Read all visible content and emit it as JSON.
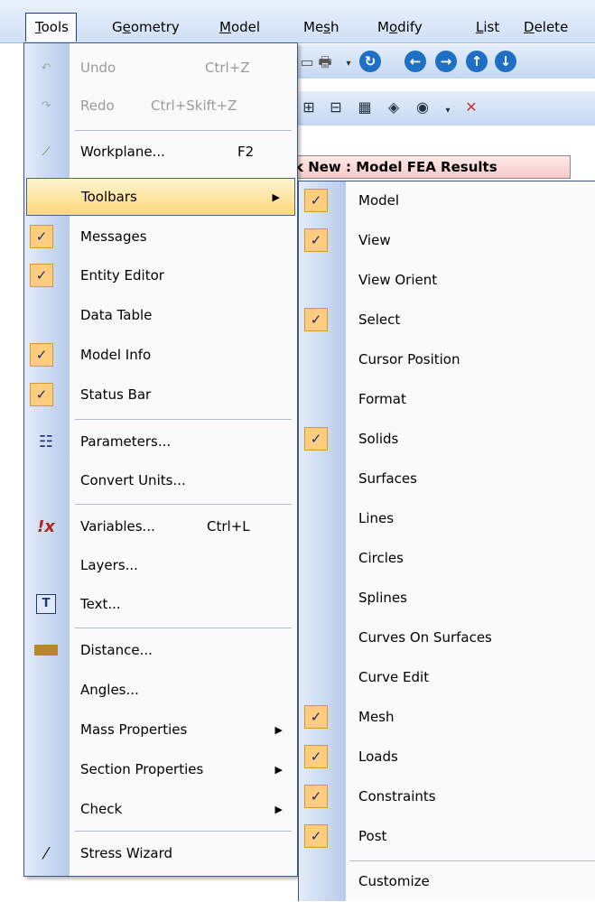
{
  "menubar": {
    "items": [
      "Tools",
      "Geometry",
      "Model",
      "Mesh",
      "Modify",
      "List",
      "Delete"
    ]
  },
  "document_tab": {
    "title": "k New : Model FEA Results"
  },
  "tools_menu": {
    "items": [
      {
        "label": "Undo",
        "shortcut": "Ctrl+Z",
        "icon": "undo-icon",
        "disabled": true
      },
      {
        "label": "Redo",
        "shortcut": "Ctrl+Skift+Z",
        "icon": "redo-icon",
        "disabled": true
      },
      {
        "label": "Workplane...",
        "shortcut": "F2",
        "icon": "workplane-icon"
      },
      {
        "label": "Toolbars",
        "submenu": true,
        "highlighted": true
      },
      {
        "label": "Messages",
        "checked": true
      },
      {
        "label": "Entity Editor",
        "checked": true
      },
      {
        "label": "Data Table"
      },
      {
        "label": "Model Info",
        "checked": true
      },
      {
        "label": "Status Bar",
        "checked": true
      },
      {
        "label": "Parameters...",
        "icon": "parameters-icon"
      },
      {
        "label": "Convert Units..."
      },
      {
        "label": "Variables...",
        "shortcut": "Ctrl+L",
        "icon": "variables-icon"
      },
      {
        "label": "Layers..."
      },
      {
        "label": "Text...",
        "icon": "text-icon"
      },
      {
        "label": "Distance...",
        "icon": "ruler-icon"
      },
      {
        "label": "Angles..."
      },
      {
        "label": "Mass Properties",
        "submenu": true
      },
      {
        "label": "Section Properties",
        "submenu": true
      },
      {
        "label": "Check",
        "submenu": true
      },
      {
        "label": "Stress Wizard",
        "icon": "wand-icon"
      }
    ]
  },
  "toolbars_submenu": {
    "items": [
      {
        "label": "Model",
        "checked": true
      },
      {
        "label": "View",
        "checked": true
      },
      {
        "label": "View Orient"
      },
      {
        "label": "Select",
        "checked": true
      },
      {
        "label": "Cursor Position"
      },
      {
        "label": "Format"
      },
      {
        "label": "Solids",
        "checked": true
      },
      {
        "label": "Surfaces"
      },
      {
        "label": "Lines"
      },
      {
        "label": "Circles"
      },
      {
        "label": "Splines"
      },
      {
        "label": "Curves On Surfaces"
      },
      {
        "label": "Curve Edit"
      },
      {
        "label": "Mesh",
        "checked": true
      },
      {
        "label": "Loads",
        "checked": true
      },
      {
        "label": "Constraints",
        "checked": true
      },
      {
        "label": "Post",
        "checked": true
      },
      {
        "label": "Customize"
      }
    ]
  },
  "colors": {
    "highlight": "#ffd97a",
    "check_bg": "#ffcc80",
    "menu_border": "#3f5683"
  }
}
